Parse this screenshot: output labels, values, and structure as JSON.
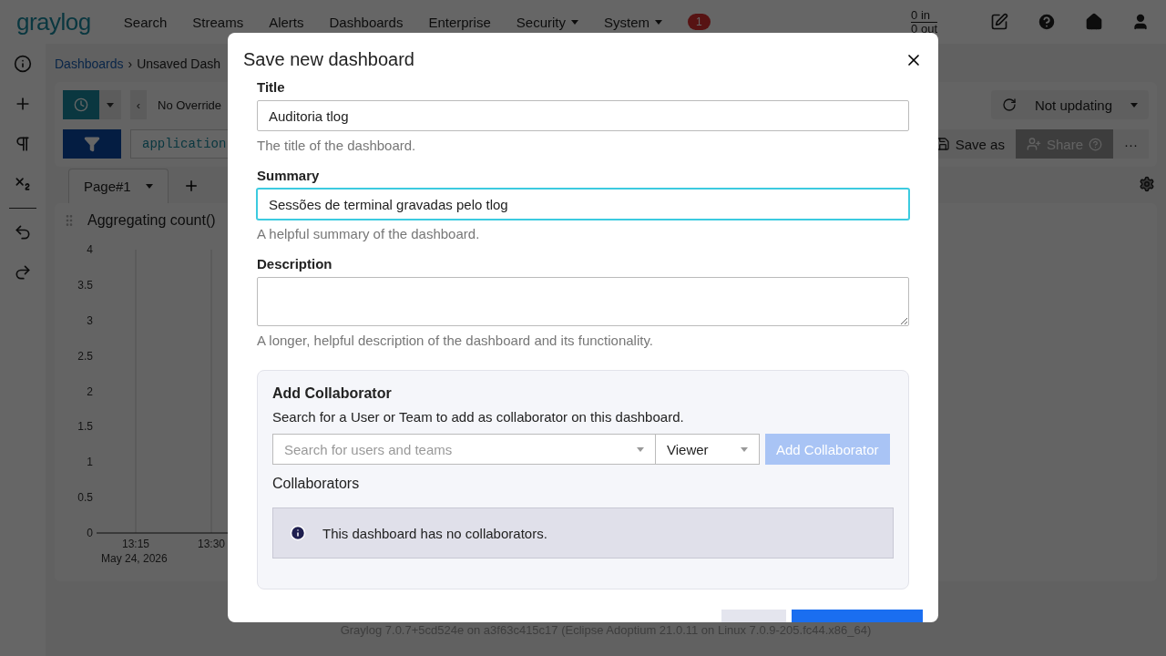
{
  "navbar": {
    "logo": "graylog",
    "items": [
      {
        "label": "Search",
        "dropdown": false
      },
      {
        "label": "Streams",
        "dropdown": false
      },
      {
        "label": "Alerts",
        "dropdown": false
      },
      {
        "label": "Dashboards",
        "dropdown": false
      },
      {
        "label": "Enterprise",
        "dropdown": false
      },
      {
        "label": "Security",
        "dropdown": true
      },
      {
        "label": "System",
        "dropdown": true
      }
    ],
    "notification_badge": "1",
    "throughput": {
      "in": "0 in",
      "out": "0 out"
    }
  },
  "breadcrumb": [
    "Dashboards",
    "›",
    "Unsaved Dash"
  ],
  "search_bar": {
    "collapse": "‹",
    "timerange": "No Override",
    "query": "application",
    "refresh": "Not updating",
    "save_as": "Save as",
    "share": {
      "label": "Share",
      "disabled": true
    },
    "more": "···"
  },
  "page_tabs": [
    {
      "label": "Page#1",
      "selected": true
    }
  ],
  "widget": {
    "title": "Aggregating count()",
    "chart_data": {
      "type": "line",
      "xlabel": "May 24, 2026",
      "categories": [
        "13:15",
        "13:30"
      ],
      "ylim": [
        0,
        4
      ],
      "yticks": [
        0,
        0.5,
        1,
        1.5,
        2,
        2.5,
        3,
        3.5,
        4
      ]
    }
  },
  "footer": "Graylog 7.0.7+5cd524e on a3f63c415c17 (Eclipse Adoptium 21.0.11 on Linux 7.0.9-205.fc44.x86_64)",
  "modal": {
    "title": "Save new dashboard",
    "fields": [
      {
        "kind": "input",
        "label": "Title",
        "value": "Auditoria tlog",
        "help": "The title of the dashboard.",
        "focused": false
      },
      {
        "kind": "input",
        "label": "Summary",
        "value": "Sessões de terminal gravadas pelo tlog",
        "help": "A helpful summary of the dashboard.",
        "focused": true
      },
      {
        "kind": "textarea",
        "label": "Description",
        "help": "A longer, helpful description of the dashboard and its functionality.",
        "focused": false
      }
    ],
    "collaborators": {
      "title": "Add Collaborator",
      "description": "Search for a User or Team to add as collaborator on this dashboard.",
      "search_placeholder": "Search for users and teams",
      "role": "Viewer",
      "add_button": {
        "label": "Add Collaborator",
        "disabled": true
      },
      "list_title": "Collaborators",
      "empty_message": "This dashboard has no collaborators."
    }
  }
}
